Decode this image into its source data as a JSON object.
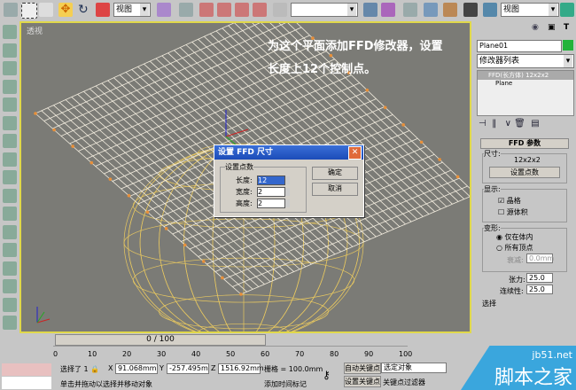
{
  "toolbar": {
    "view_select": "视图",
    "selection_set": "",
    "render_view_select": "视图"
  },
  "viewport": {
    "label": "透视",
    "annotation_line1": "为这个平面添加FFD修改器，设置",
    "annotation_line2": "长度上12个控制点。"
  },
  "panel": {
    "object_name": "Plane01",
    "object_color": "#22b33a",
    "modifier_list": "修改器列表",
    "stack": [
      "FFD(长方体) 12x2x2",
      "Plane"
    ],
    "rollout_title": "FFD 参数",
    "size_group": "尺寸:",
    "size_value": "12x2x2",
    "set_points_button": "设置点数",
    "display_group": "显示:",
    "lattice_label": "晶格",
    "source_volume_label": "源体积",
    "lattice_checked": true,
    "source_volume_checked": false,
    "deform_group": "变形:",
    "only_in_volume": "仅在体内",
    "all_vertices": "所有顶点",
    "falloff_label": "衰减:",
    "falloff_value": "0.0mm",
    "tension_label": "张力:",
    "tension_value": "25.0",
    "continuity_label": "连续性:",
    "continuity_value": "25.0",
    "more": "选择"
  },
  "dialog": {
    "title": "设置 FFD 尺寸",
    "group": "设置点数",
    "length_label": "长度:",
    "length_value": "12",
    "width_label": "宽度:",
    "width_value": "2",
    "height_label": "高度:",
    "height_value": "2",
    "ok": "确定",
    "cancel": "取消"
  },
  "timeline": {
    "frame": "0 / 100",
    "ticks": [
      "0",
      "10",
      "20",
      "30",
      "40",
      "50",
      "60",
      "70",
      "80",
      "90",
      "100"
    ]
  },
  "status": {
    "selected": "选择了 1",
    "x_label": "X",
    "x_value": "91.068mm",
    "y_label": "Y",
    "y_value": "-257.495m",
    "z_label": "Z",
    "z_value": "1516.92mm",
    "grid": "栅格 = 100.0mm",
    "auto_key": "自动关键点",
    "set_key": "设置关键点",
    "key_mode": "选定对象",
    "key_filters": "关键点过滤器",
    "prompt": "单击并拖动以选择并移动对象",
    "add_time_tag": "添加时间标记"
  },
  "watermark": {
    "site": "jb51.net",
    "name": "脚本之家"
  }
}
